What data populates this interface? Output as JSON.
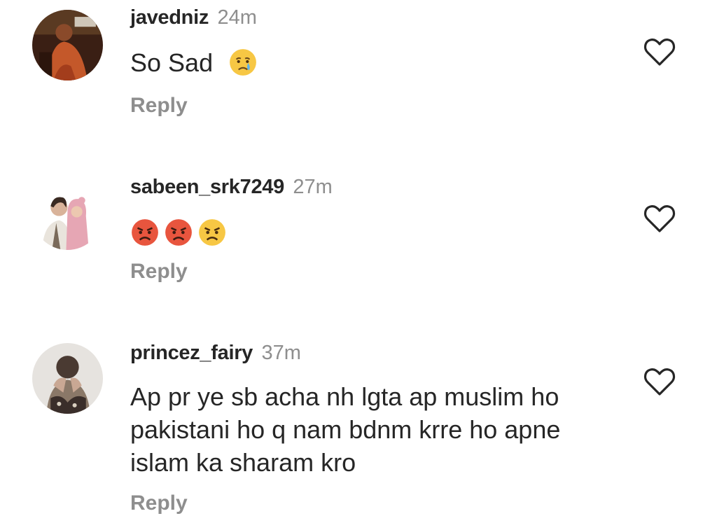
{
  "comments": [
    {
      "username": "javedniz",
      "time": "24m",
      "text": "So Sad",
      "emojis": [
        "crying-face-emoji"
      ],
      "reply_label": "Reply",
      "avatar_icon": "user-avatar-javedniz",
      "like_icon": "heart-outline-icon"
    },
    {
      "username": "sabeen_srk7249",
      "time": "27m",
      "text": "",
      "emojis": [
        "pouting-face-emoji",
        "pouting-face-emoji",
        "angry-face-emoji"
      ],
      "reply_label": "Reply",
      "avatar_icon": "user-avatar-sabeen",
      "like_icon": "heart-outline-icon"
    },
    {
      "username": "princez_fairy",
      "time": "37m",
      "text": "Ap pr ye sb acha nh lgta ap muslim ho pakistani ho q nam bdnm krre ho apne islam ka sharam kro",
      "emojis": [],
      "reply_label": "Reply",
      "avatar_icon": "user-avatar-princez",
      "like_icon": "heart-outline-icon"
    }
  ],
  "colors": {
    "text": "#262626",
    "secondary": "#8e8e8e",
    "emoji_yellow": "#f7c744",
    "emoji_red": "#e8553e"
  }
}
